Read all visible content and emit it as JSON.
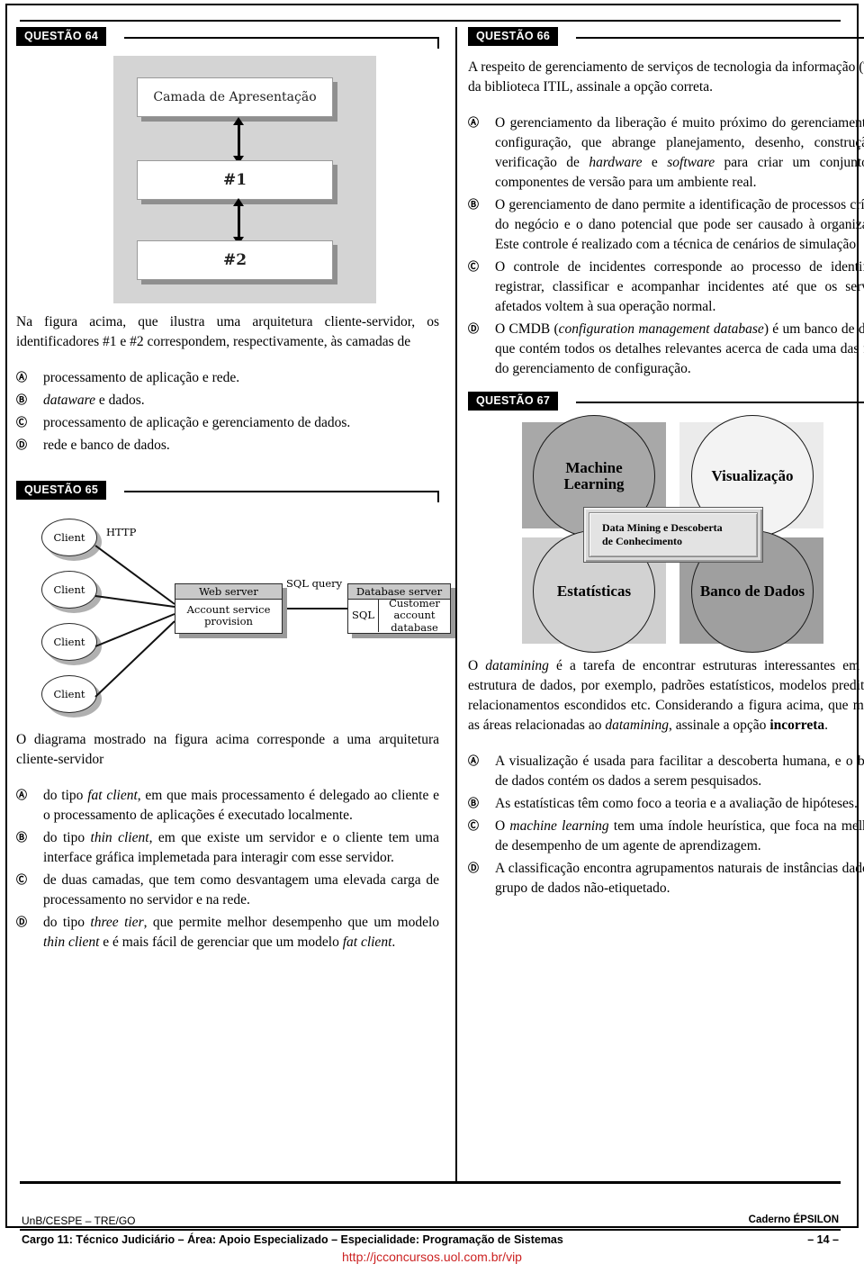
{
  "footer": {
    "org": "UnB/CESPE – TRE/GO",
    "caderno": "Caderno ÉPSILON",
    "cargo": "Cargo 11: Técnico Judiciário – Área: Apoio Especializado – Especialidade: Programação de Sistemas",
    "page": "– 14 –",
    "watermark": "http://jcconcursos.uol.com.br/vip"
  },
  "q64": {
    "tag": "QUESTÃO 64",
    "figure": {
      "layer1": "Camada de Apresentação",
      "layer2": "#1",
      "layer3": "#2"
    },
    "stem": "Na figura acima, que ilustra uma arquitetura cliente-servidor, os identificadores #1 e #2 correspondem, respectivamente, às camadas de",
    "options": [
      {
        "letter": "A",
        "text": "processamento de aplicação e rede."
      },
      {
        "letter": "B",
        "text": "dataware e dados."
      },
      {
        "letter": "C",
        "text": "processamento de aplicação e gerenciamento de dados."
      },
      {
        "letter": "D",
        "text": "rede e banco de dados."
      }
    ]
  },
  "q65": {
    "tag": "QUESTÃO 65",
    "figure": {
      "clients": [
        "Client",
        "Client",
        "Client",
        "Client"
      ],
      "http_label": "HTTP",
      "sql_query_label": "SQL query",
      "web_server_title": "Web server",
      "web_server_body": "Account service provision",
      "db_server_title": "Database server",
      "db_sql_cell": "SQL",
      "db_body": "Customer account database"
    },
    "stem": "O diagrama mostrado na figura acima corresponde a uma arquitetura cliente-servidor",
    "options": [
      {
        "letter": "A",
        "text": "do tipo fat client, em que mais processamento é delegado ao cliente e o processamento de aplicações é executado localmente."
      },
      {
        "letter": "B",
        "text": "do tipo thin client, em que existe um servidor e o cliente tem uma interface gráfica implemetada para interagir com esse servidor."
      },
      {
        "letter": "C",
        "text": "de duas camadas, que tem como desvantagem uma elevada carga de processamento no servidor e na rede."
      },
      {
        "letter": "D",
        "text": "do tipo three tier, que permite melhor desempenho que um modelo thin client e é mais fácil de gerenciar que um modelo fat client."
      }
    ]
  },
  "q66": {
    "tag": "QUESTÃO 66",
    "stem": "A respeito de gerenciamento de serviços de tecnologia da informação (TI) e da biblioteca ITIL, assinale a opção correta.",
    "options": [
      {
        "letter": "A",
        "text": "O gerenciamento da liberação é muito próximo do gerenciamento da configuração, que abrange planejamento, desenho, construção e verificação de hardware e software para criar um conjunto de componentes de versão para um ambiente real."
      },
      {
        "letter": "B",
        "text": "O gerenciamento de dano permite a identificação de processos críticos do negócio e o dano potencial que pode ser causado à organização. Este controle é realizado com a técnica de cenários de simulação."
      },
      {
        "letter": "C",
        "text": "O controle de incidentes corresponde ao processo de identificar, registrar, classificar e acompanhar incidentes até que os serviços afetados voltem à sua operação normal."
      },
      {
        "letter": "D",
        "text": "O CMDB (configuration management database) é um banco de dados que contém todos os detalhes relevantes acerca de cada uma das fases do gerenciamento de configuração."
      }
    ]
  },
  "q67": {
    "tag": "QUESTÃO 67",
    "figure": {
      "c1": "Machine Learning",
      "c2": "Visualização",
      "c3": "Estatísticas",
      "c4": "Banco de Dados",
      "center_line1": "Data Mining e Descoberta",
      "center_line2": "de Conhecimento"
    },
    "stem": "O datamining é a tarefa de encontrar estruturas interessantes em uma estrutura de dados, por exemplo, padrões estatísticos, modelos preditivos, relacionamentos escondidos etc. Considerando a figura acima, que mostra as áreas relacionadas ao datamining, assinale a opção incorreta.",
    "options": [
      {
        "letter": "A",
        "text": "A visualização é usada para facilitar a descoberta humana, e o banco de dados contém os dados a serem pesquisados."
      },
      {
        "letter": "B",
        "text": "As estatísticas têm como foco a teoria e a avaliação de hipóteses."
      },
      {
        "letter": "C",
        "text": "O machine learning tem uma índole heurística, que foca na melhoria de desempenho de um agente de aprendizagem."
      },
      {
        "letter": "D",
        "text": "A classificação encontra agrupamentos naturais de instâncias dado um grupo de dados não-etiquetado."
      }
    ]
  }
}
